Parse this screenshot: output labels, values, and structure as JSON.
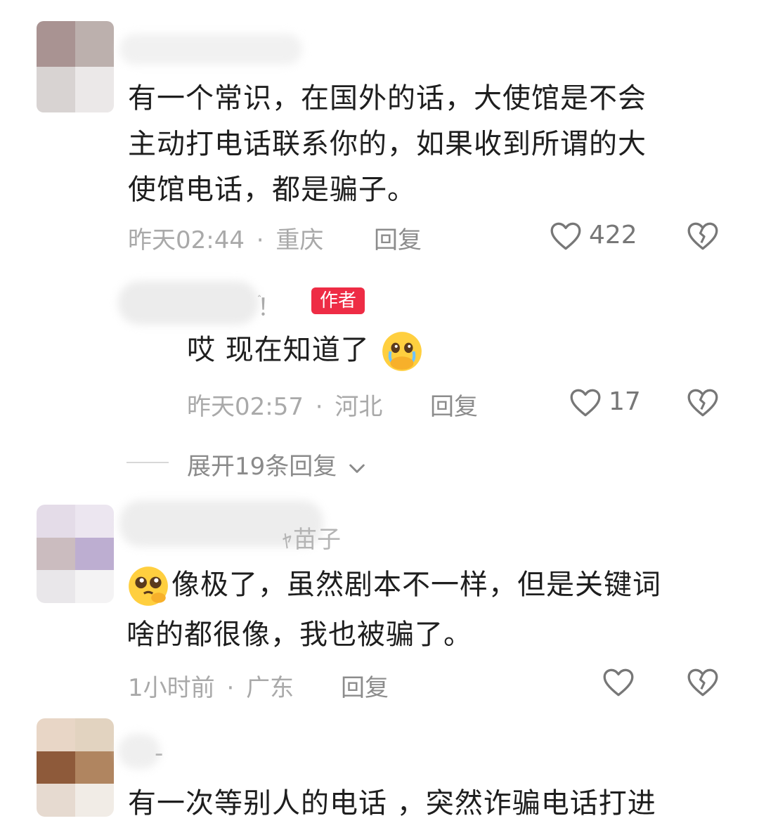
{
  "comments": [
    {
      "text_lines": [
        "有一个常识，在国外的话，大使馆是不会",
        "主动打电话联系你的，如果收到所谓的大",
        "使馆电话，都是骗子。"
      ],
      "time": "昨天02:44",
      "location": "重庆",
      "reply_label": "回复",
      "likes": "422",
      "replies": [
        {
          "username_fragment": "ۛ！",
          "badge": "作者",
          "text": "哎 现在知道了",
          "time": "昨天02:57",
          "location": "河北",
          "reply_label": "回复",
          "likes": "17"
        }
      ],
      "expand_label": "展开19条回复"
    },
    {
      "username_fragment": "ｬ苗子",
      "text_line1": "像极了，虽然剧本不一样，但是关键词",
      "text_line2": "啥的都很像，我也被骗了。",
      "time": "1小时前",
      "location": "广东",
      "reply_label": "回复"
    },
    {
      "username_fragment": "-",
      "text_line1": "有一次等别人的电话 ，突然诈骗电话打进"
    }
  ],
  "separator": "·",
  "icons": {
    "like": "heart-outline-icon",
    "dislike": "broken-heart-icon",
    "expand": "chevron-down-icon",
    "emoji_cry": "crying-face-emoji",
    "emoji_pleading": "pleading-face-emoji"
  }
}
